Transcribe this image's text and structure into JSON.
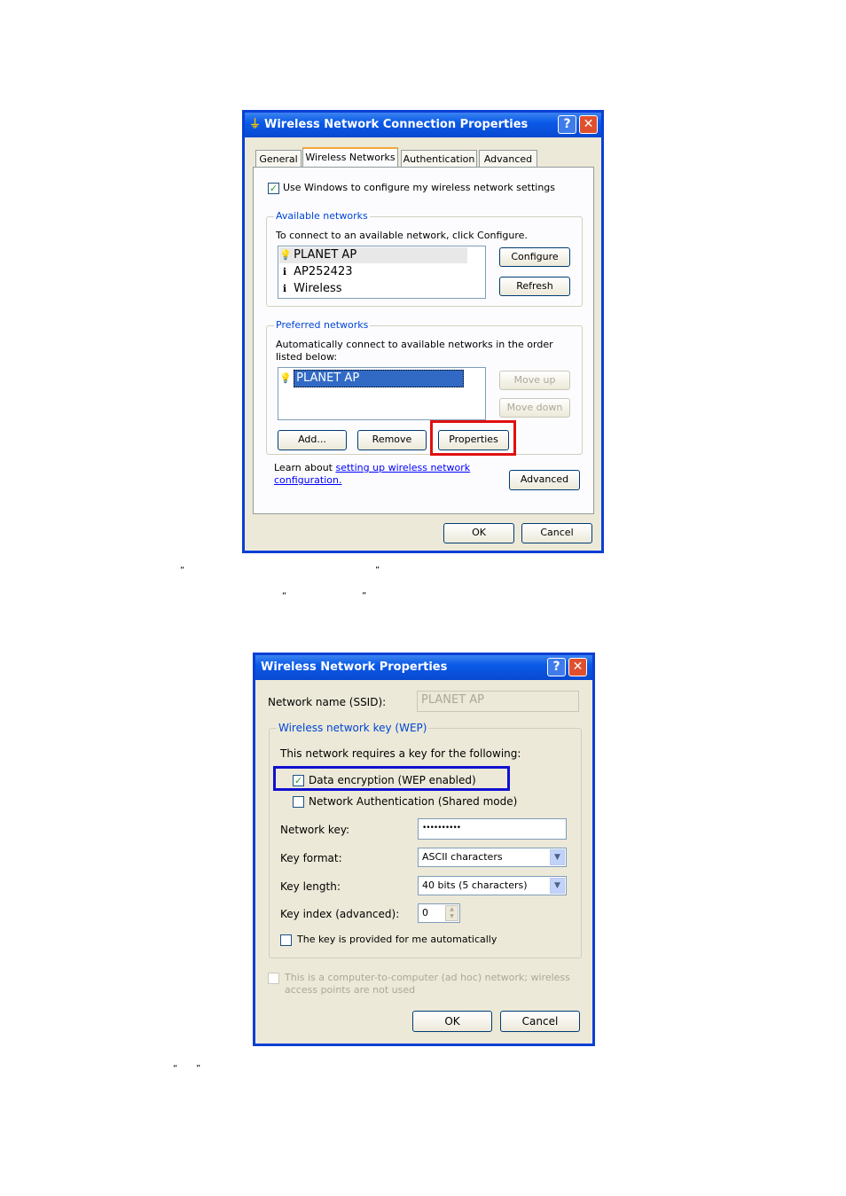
{
  "dialog1": {
    "title": "Wireless Network Connection Properties",
    "help_glyph": "?",
    "close_glyph": "✕",
    "tabs": [
      "General",
      "Wireless Networks",
      "Authentication",
      "Advanced"
    ],
    "use_windows_label": "Use Windows to configure my wireless network settings",
    "available": {
      "legend": "Available networks",
      "desc": "To connect to an available network, click Configure.",
      "items": [
        "PLANET AP",
        "AP252423",
        "Wireless"
      ],
      "configure": "Configure",
      "refresh": "Refresh"
    },
    "preferred": {
      "legend": "Preferred networks",
      "desc": "Automatically connect to available networks in the order listed below:",
      "items": [
        "PLANET AP"
      ],
      "move_up": "Move up",
      "move_down": "Move down",
      "add": "Add...",
      "remove": "Remove",
      "properties": "Properties"
    },
    "learn_prefix": "Learn about ",
    "learn_link": "setting up wireless network configuration.",
    "advanced": "Advanced",
    "ok": "OK",
    "cancel": "Cancel"
  },
  "dialog2": {
    "title": "Wireless Network Properties",
    "help_glyph": "?",
    "close_glyph": "✕",
    "ssid_label": "Network name (SSID):",
    "ssid_value": "PLANET AP",
    "wep_legend": "Wireless network key (WEP)",
    "requires": "This network requires a key for the following:",
    "data_encryption": "Data encryption (WEP enabled)",
    "network_auth": "Network Authentication (Shared mode)",
    "key_label": "Network key:",
    "key_value": "••••••••••",
    "format_label": "Key format:",
    "format_value": "ASCII characters",
    "length_label": "Key length:",
    "length_value": "40 bits (5 characters)",
    "index_label": "Key index (advanced):",
    "index_value": "0",
    "auto_key": "The key is provided for me automatically",
    "adhoc": "This is a computer-to-computer (ad hoc) network; wireless access points are not used",
    "ok": "OK",
    "cancel": "Cancel"
  },
  "quotes": {
    "open": "“",
    "close": "”"
  }
}
